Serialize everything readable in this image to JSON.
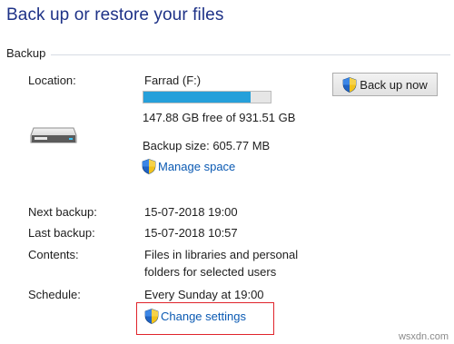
{
  "page": {
    "title": "Back up or restore your files",
    "section_label": "Backup"
  },
  "backup": {
    "location_label": "Location:",
    "location_value": "Farrad (F:)",
    "drive_used_fraction": 0.842,
    "free_space": "147.88 GB free of 931.51 GB",
    "backup_size": "Backup size: 605.77 MB",
    "manage_space_link": "Manage space",
    "back_up_now_button": "Back up now",
    "next_backup_label": "Next backup:",
    "next_backup_value": "15-07-2018 19:00",
    "last_backup_label": "Last backup:",
    "last_backup_value": "15-07-2018 10:57",
    "contents_label": "Contents:",
    "contents_value_line1": "Files in libraries and personal",
    "contents_value_line2": "folders for selected users",
    "schedule_label": "Schedule:",
    "schedule_value": "Every Sunday at 19:00",
    "change_settings_link": "Change settings"
  },
  "colors": {
    "title": "#1e3287",
    "link": "#0b5ab3",
    "progress_fill": "#26a0da",
    "highlight_box": "#e0242b"
  },
  "icons": {
    "drive": "drive-icon",
    "uac_shield": "uac-shield-icon"
  },
  "watermark": "wsxdn.com"
}
